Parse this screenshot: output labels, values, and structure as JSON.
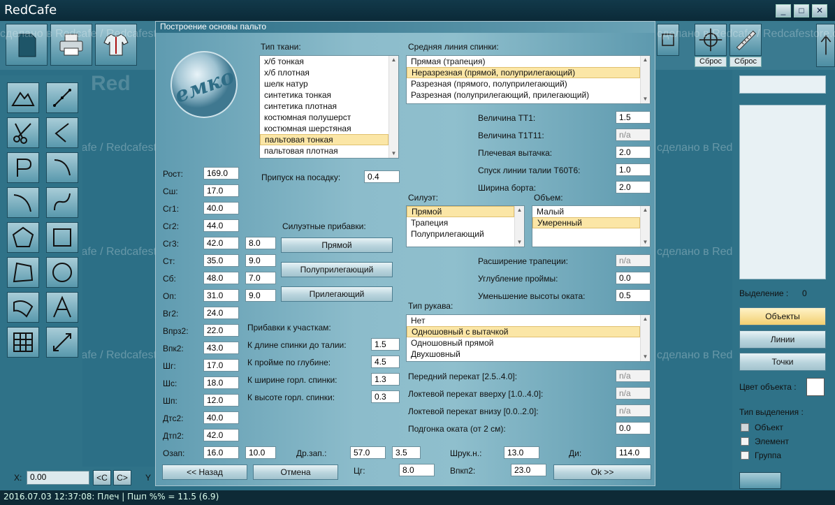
{
  "app": {
    "title": "RedCafe"
  },
  "window_buttons": [
    "_",
    "□",
    "✕"
  ],
  "toolbar_right": {
    "reset1": "Сброс",
    "reset2": "Сброс"
  },
  "watermark_text": "сделано в Redcafe / Redcafestore.com /",
  "watermark_brand": "Red",
  "dialog": {
    "title": "Построение основы пальто",
    "fabric": {
      "label": "Тип ткани:",
      "items": [
        "х/б тонкая",
        "х/б плотная",
        "шелк натур",
        "синтетика тонкая",
        "синтетика плотная",
        "костюмная полушерст",
        "костюмная шерстяная",
        "пальтовая тонкая",
        "пальтовая плотная"
      ],
      "selected": 7
    },
    "back_line": {
      "label": "Средняя линия спинки:",
      "items": [
        "Прямая (трапеция)",
        "Неразрезная (прямой, полуприлегающий)",
        "Разрезная (прямого, полуприлегающий)",
        "Разрезная (полуприлегающий, прилегающий)"
      ],
      "selected": 1
    },
    "silhouette": {
      "label": "Силуэт:",
      "items": [
        "Прямой",
        "Трапеция",
        "Полуприлегающий"
      ],
      "selected": 0
    },
    "volume": {
      "label": "Объем:",
      "items": [
        "Малый",
        "Умеренный"
      ],
      "selected": 1
    },
    "sleeve": {
      "label": "Тип рукава:",
      "items": [
        "Нет",
        "Одношовный с вытачкой",
        "Одношовный прямой",
        "Двухшовный"
      ],
      "selected": 1
    },
    "measures": [
      {
        "label": "Рост:",
        "v1": "169.0"
      },
      {
        "label": "Сш:",
        "v1": "17.0"
      },
      {
        "label": "Сг1:",
        "v1": "40.0"
      },
      {
        "label": "Сг2:",
        "v1": "44.0"
      },
      {
        "label": "Сг3:",
        "v1": "42.0",
        "v2": "8.0"
      },
      {
        "label": "Ст:",
        "v1": "35.0",
        "v2": "9.0"
      },
      {
        "label": "Сб:",
        "v1": "48.0",
        "v2": "7.0"
      },
      {
        "label": "Оп:",
        "v1": "31.0",
        "v2": "9.0"
      },
      {
        "label": "Вг2:",
        "v1": "24.0"
      },
      {
        "label": "Впрз2:",
        "v1": "22.0"
      },
      {
        "label": "Впк2:",
        "v1": "43.0"
      },
      {
        "label": "Шг:",
        "v1": "17.0"
      },
      {
        "label": "Шс:",
        "v1": "18.0"
      },
      {
        "label": "Шп:",
        "v1": "12.0"
      },
      {
        "label": "Дтс2:",
        "v1": "40.0"
      },
      {
        "label": "Дтп2:",
        "v1": "42.0"
      }
    ],
    "ease": {
      "label": "Припуск на посадку:",
      "value": "0.4"
    },
    "silhouette_ease": {
      "label": "Силуэтные прибавки:",
      "buttons": [
        "Прямой",
        "Полуприлегающий",
        "Прилегающий"
      ]
    },
    "section_ease": {
      "label": "Прибавки к участкам:",
      "rows": [
        {
          "label": "К длине спинки до талии:",
          "value": "1.5"
        },
        {
          "label": "К пройме по глубине:",
          "value": "4.5"
        },
        {
          "label": "К ширине горл. спинки:",
          "value": "1.3"
        },
        {
          "label": "К высоте горл. спинки:",
          "value": "0.3"
        }
      ]
    },
    "right_fields": [
      {
        "label": "Величина ТТ1:",
        "value": "1.5",
        "disabled": false
      },
      {
        "label": "Величина Т1Т11:",
        "value": "n/a",
        "disabled": true
      },
      {
        "label": "Плечевая вытачка:",
        "value": "2.0",
        "disabled": false
      },
      {
        "label": "Спуск линии талии Т60Т6:",
        "value": "1.0",
        "disabled": false
      },
      {
        "label": "Ширина борта:",
        "value": "2.0",
        "disabled": false
      }
    ],
    "mid_fields": [
      {
        "label": "Расширение трапеции:",
        "value": "n/a",
        "disabled": true
      },
      {
        "label": "Углубление проймы:",
        "value": "0.0",
        "disabled": false
      },
      {
        "label": "Уменьшение высоты оката:",
        "value": "0.5",
        "disabled": false
      }
    ],
    "sleeve_fields": [
      {
        "label": "Передний перекат [2.5..4.0]:",
        "value": "n/a",
        "disabled": true
      },
      {
        "label": "Локтевой перекат вверху [1.0..4.0]:",
        "value": "n/a",
        "disabled": true
      },
      {
        "label": "Локтевой перекат внизу [0.0..2.0]:",
        "value": "n/a",
        "disabled": true
      },
      {
        "label": "Подгонка оката (от 2 см):",
        "value": "0.0",
        "disabled": false
      }
    ],
    "bottom_row": {
      "ozap_label": "Озап:",
      "ozap1": "16.0",
      "ozap2": "10.0",
      "drzap_label": "Др.зап.:",
      "drzap1": "57.0",
      "drzap2": "3.5",
      "shruk_label": "Шрук.н.:",
      "shruk": "13.0",
      "di_label": "Ди:",
      "di": "114.0",
      "cg_label": "Цг:",
      "cg": "8.0",
      "vpkp_label": "Впкп2:",
      "vpkp": "23.0"
    },
    "buttons": {
      "back": "<< Назад",
      "cancel": "Отмена",
      "ok": "Ok >>"
    }
  },
  "right_panel": {
    "selection_label": "Выделение :",
    "selection_count": "0",
    "buttons": [
      "Объекты",
      "Линии",
      "Точки"
    ],
    "color_label": "Цвет объекта :",
    "select_type_label": "Тип выделения :",
    "select_types": [
      "Объект",
      "Элемент",
      "Группа"
    ]
  },
  "coords": {
    "x_label": "X:",
    "x_value": "0.00",
    "prev": "<C",
    "next": "C>",
    "y_label": "Y"
  },
  "status": {
    "text": "2016.07.03 12:37:08: Плеч | Пшп %% = 11.5 (6.9)"
  }
}
